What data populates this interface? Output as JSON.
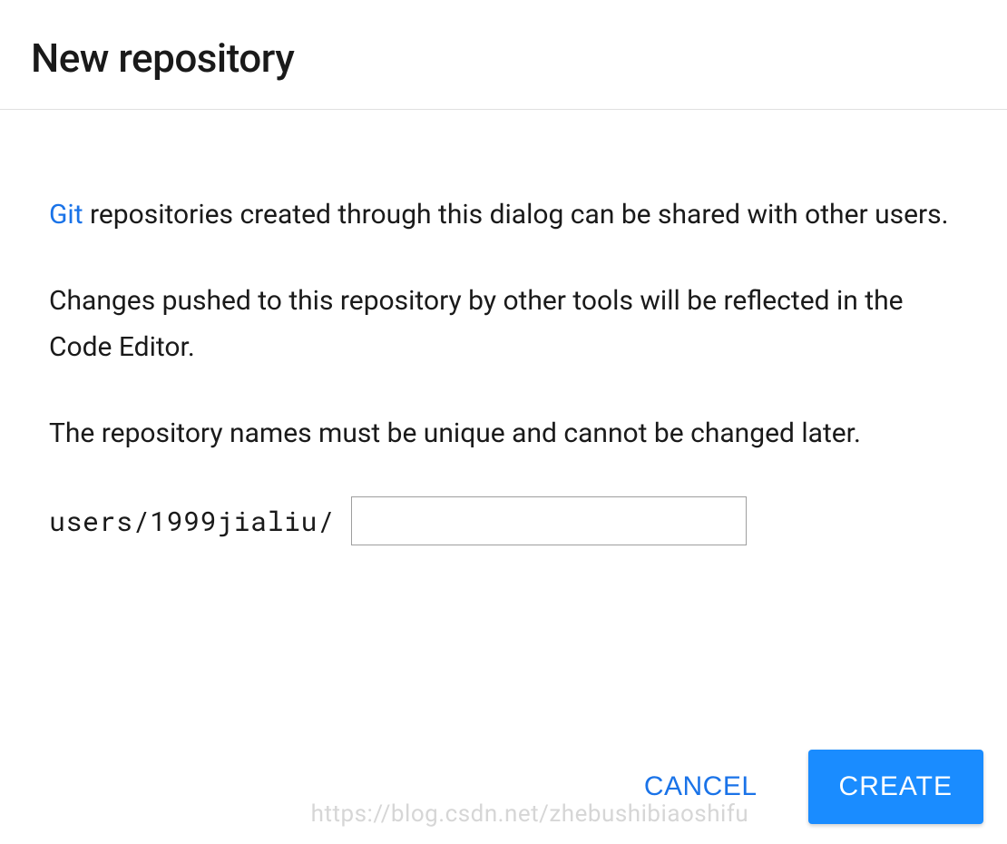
{
  "header": {
    "title": "New repository"
  },
  "body": {
    "git_link_text": "Git",
    "para1_rest": " repositories created through this dialog can be shared with other users.",
    "para2": "Changes pushed to this repository by other tools will be reflected in the Code Editor.",
    "para3": "The repository names must be unique and cannot be changed later.",
    "path_prefix": "users/1999jialiu/",
    "repo_name_value": ""
  },
  "actions": {
    "cancel_label": "CANCEL",
    "create_label": "CREATE"
  },
  "watermark": "https://blog.csdn.net/zhebushibiaoshifu"
}
